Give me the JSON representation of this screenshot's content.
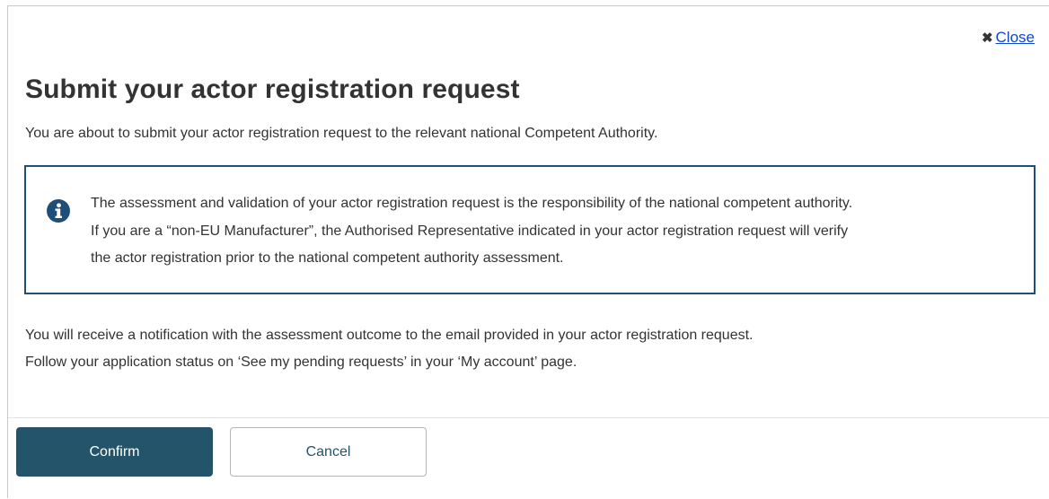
{
  "dialog": {
    "close_label": "Close",
    "close_symbol": "✖",
    "title": "Submit your actor registration request",
    "intro": "You are about to submit your actor registration request to the relevant national Competent Authority.",
    "info": {
      "icon": "info-circle-icon",
      "lines": [
        "The assessment and validation of your actor registration request is the responsibility of the national competent authority.",
        "If you are a “non-EU Manufacturer”, the Authorised Representative indicated in your actor registration request will verify",
        "the actor registration prior to the national competent authority assessment."
      ]
    },
    "notice_lines": [
      "You will receive a notification with the assessment outcome to the email provided in your actor registration request.",
      "Follow your application status on ‘See my pending requests’ in your ‘My account’ page."
    ],
    "buttons": {
      "confirm_label": "Confirm",
      "cancel_label": "Cancel"
    }
  },
  "colors": {
    "primary": "#24546a",
    "info_border": "#1f4e79",
    "link": "#0e47cb",
    "text": "#333333"
  }
}
